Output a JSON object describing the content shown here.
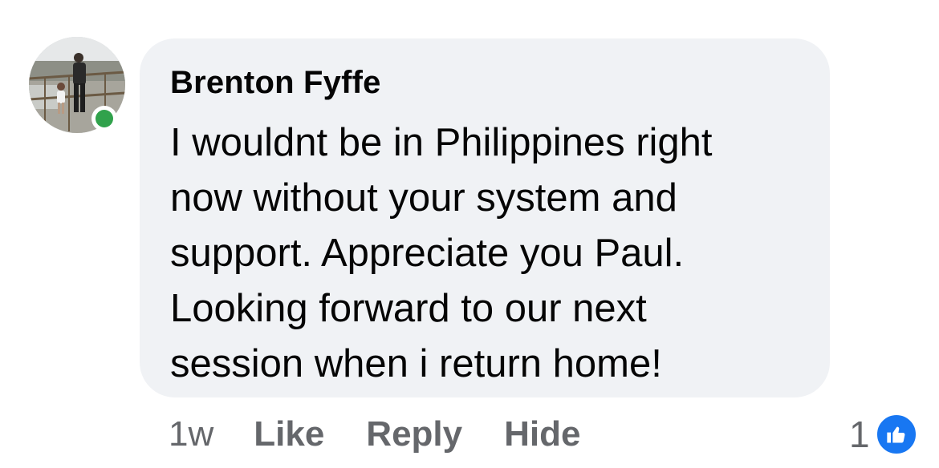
{
  "comment": {
    "author": "Brenton Fyffe",
    "text": "I wouldnt be in Philippines right\nnow without your system and\nsupport. Appreciate you Paul.\nLooking forward to our next\nsession when i return home!",
    "online_status_color": "#31a24c",
    "bubble_color": "#f0f2f5"
  },
  "actions": {
    "timestamp": "1w",
    "like_label": "Like",
    "reply_label": "Reply",
    "hide_label": "Hide"
  },
  "reactions": {
    "count": "1",
    "icon": "thumbs-up-icon",
    "icon_color": "#1877f2"
  }
}
